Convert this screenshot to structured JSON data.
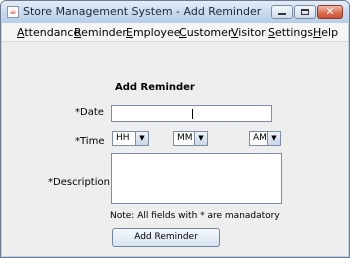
{
  "window": {
    "title": "Store Management System - Add Reminder",
    "close_glyph": "✕",
    "app_icon_glyph": "☕"
  },
  "menu": [
    {
      "first": "A",
      "rest": "ttendance"
    },
    {
      "first": "R",
      "rest": "eminder"
    },
    {
      "first": "E",
      "rest": "mployee"
    },
    {
      "first": "C",
      "rest": "ustomer"
    },
    {
      "first": "V",
      "rest": "isitor"
    },
    {
      "first": "S",
      "rest": "ettings"
    },
    {
      "first": "H",
      "rest": "elp"
    }
  ],
  "form": {
    "heading": "Add Reminder",
    "date_label": "*Date",
    "date_value": "",
    "time_label": "*Time",
    "hour": {
      "selected": "HH",
      "arrow": "▼"
    },
    "minute": {
      "selected": "MM",
      "arrow": "▼"
    },
    "ampm": {
      "selected": "AM",
      "arrow": "▼"
    },
    "description_label": "*Description",
    "description_value": "",
    "note": "Note: All fields with * are manadatory",
    "submit_label": "Add Reminder"
  },
  "colors": {
    "titlebar": "#c7daef",
    "close_button": "#d96a4e",
    "panel": "#eeeeee",
    "menubar": "#f5f5f5"
  }
}
